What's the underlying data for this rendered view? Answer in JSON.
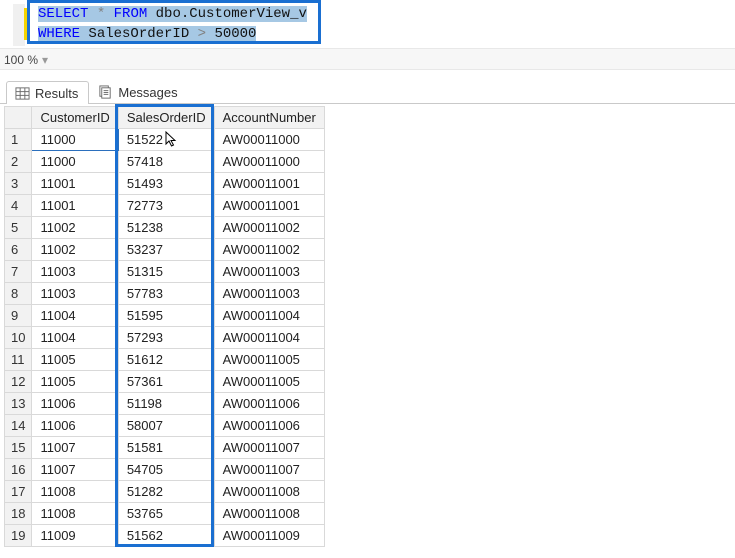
{
  "query": {
    "line1_select": "SELECT",
    "line1_star": " * ",
    "line1_from": "FROM",
    "line1_obj": " dbo.CustomerView_v",
    "line2_where": "WHERE",
    "line2_col": " SalesOrderID ",
    "line2_op": ">",
    "line2_val": " 50000"
  },
  "zoom": {
    "label": "100 %"
  },
  "tabs": {
    "results": "Results",
    "messages": "Messages"
  },
  "columns": {
    "c1": "CustomerID",
    "c2": "SalesOrderID",
    "c3": "AccountNumber"
  },
  "rows": [
    {
      "n": "1",
      "c1": "11000",
      "c2": "51522",
      "c3": "AW00011000"
    },
    {
      "n": "2",
      "c1": "11000",
      "c2": "57418",
      "c3": "AW00011000"
    },
    {
      "n": "3",
      "c1": "11001",
      "c2": "51493",
      "c3": "AW00011001"
    },
    {
      "n": "4",
      "c1": "11001",
      "c2": "72773",
      "c3": "AW00011001"
    },
    {
      "n": "5",
      "c1": "11002",
      "c2": "51238",
      "c3": "AW00011002"
    },
    {
      "n": "6",
      "c1": "11002",
      "c2": "53237",
      "c3": "AW00011002"
    },
    {
      "n": "7",
      "c1": "11003",
      "c2": "51315",
      "c3": "AW00011003"
    },
    {
      "n": "8",
      "c1": "11003",
      "c2": "57783",
      "c3": "AW00011003"
    },
    {
      "n": "9",
      "c1": "11004",
      "c2": "51595",
      "c3": "AW00011004"
    },
    {
      "n": "10",
      "c1": "11004",
      "c2": "57293",
      "c3": "AW00011004"
    },
    {
      "n": "11",
      "c1": "11005",
      "c2": "51612",
      "c3": "AW00011005"
    },
    {
      "n": "12",
      "c1": "11005",
      "c2": "57361",
      "c3": "AW00011005"
    },
    {
      "n": "13",
      "c1": "11006",
      "c2": "51198",
      "c3": "AW00011006"
    },
    {
      "n": "14",
      "c1": "11006",
      "c2": "58007",
      "c3": "AW00011006"
    },
    {
      "n": "15",
      "c1": "11007",
      "c2": "51581",
      "c3": "AW00011007"
    },
    {
      "n": "16",
      "c1": "11007",
      "c2": "54705",
      "c3": "AW00011007"
    },
    {
      "n": "17",
      "c1": "11008",
      "c2": "51282",
      "c3": "AW00011008"
    },
    {
      "n": "18",
      "c1": "11008",
      "c2": "53765",
      "c3": "AW00011008"
    },
    {
      "n": "19",
      "c1": "11009",
      "c2": "51562",
      "c3": "AW00011009"
    }
  ]
}
